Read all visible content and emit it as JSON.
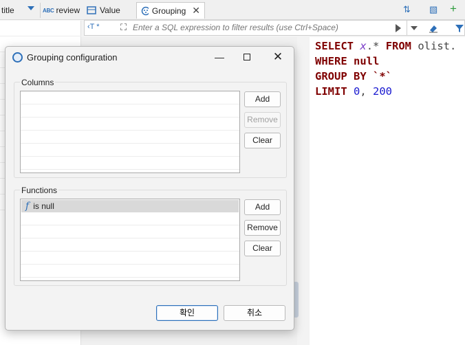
{
  "toolbar": {
    "column_title": "title",
    "column_review": "review",
    "abc_badge": "ABC",
    "tab_value": "Value",
    "tab_grouping": "Grouping",
    "close_glyph": "✕"
  },
  "filter": {
    "prefix": "‹T *",
    "placeholder": "Enter a SQL expression to filter results (use Ctrl+Space)"
  },
  "sql": {
    "line1": {
      "kw1": "SELECT",
      "alias": "x",
      "rest": ".* ",
      "kw2": "FROM",
      "ident": " olist."
    },
    "line2": {
      "kw": "WHERE",
      "ident": " null"
    },
    "line3": {
      "kw": "GROUP BY",
      "ident": " `*`"
    },
    "line4": {
      "kw": "LIMIT",
      "num1": " 0",
      "sep": ",",
      "num2": " 200"
    }
  },
  "dialog": {
    "title": "Grouping configuration",
    "minimize_glyph": "—",
    "close_glyph": "✕",
    "columns": {
      "label": "Columns",
      "add": "Add",
      "remove": "Remove",
      "clear": "Clear"
    },
    "functions": {
      "label": "Functions",
      "items": [
        "is null"
      ],
      "fn_glyph": "f",
      "add": "Add",
      "remove": "Remove",
      "clear": "Clear"
    },
    "ok": "확인",
    "cancel": "취소"
  },
  "colors": {
    "accent": "#2d6fb8",
    "keyword": "#7f0000",
    "number": "#1a1ad0",
    "alias": "#7a3cc8"
  }
}
